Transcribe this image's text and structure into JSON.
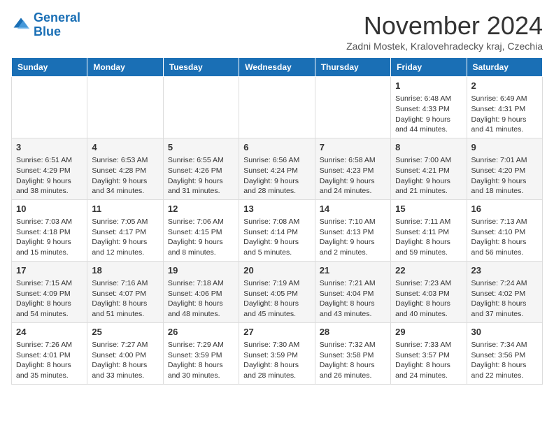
{
  "logo": {
    "line1": "General",
    "line2": "Blue"
  },
  "title": "November 2024",
  "location": "Zadni Mostek, Kralovehradecky kraj, Czechia",
  "weekdays": [
    "Sunday",
    "Monday",
    "Tuesday",
    "Wednesday",
    "Thursday",
    "Friday",
    "Saturday"
  ],
  "weeks": [
    [
      {
        "day": "",
        "info": ""
      },
      {
        "day": "",
        "info": ""
      },
      {
        "day": "",
        "info": ""
      },
      {
        "day": "",
        "info": ""
      },
      {
        "day": "",
        "info": ""
      },
      {
        "day": "1",
        "info": "Sunrise: 6:48 AM\nSunset: 4:33 PM\nDaylight: 9 hours\nand 44 minutes."
      },
      {
        "day": "2",
        "info": "Sunrise: 6:49 AM\nSunset: 4:31 PM\nDaylight: 9 hours\nand 41 minutes."
      }
    ],
    [
      {
        "day": "3",
        "info": "Sunrise: 6:51 AM\nSunset: 4:29 PM\nDaylight: 9 hours\nand 38 minutes."
      },
      {
        "day": "4",
        "info": "Sunrise: 6:53 AM\nSunset: 4:28 PM\nDaylight: 9 hours\nand 34 minutes."
      },
      {
        "day": "5",
        "info": "Sunrise: 6:55 AM\nSunset: 4:26 PM\nDaylight: 9 hours\nand 31 minutes."
      },
      {
        "day": "6",
        "info": "Sunrise: 6:56 AM\nSunset: 4:24 PM\nDaylight: 9 hours\nand 28 minutes."
      },
      {
        "day": "7",
        "info": "Sunrise: 6:58 AM\nSunset: 4:23 PM\nDaylight: 9 hours\nand 24 minutes."
      },
      {
        "day": "8",
        "info": "Sunrise: 7:00 AM\nSunset: 4:21 PM\nDaylight: 9 hours\nand 21 minutes."
      },
      {
        "day": "9",
        "info": "Sunrise: 7:01 AM\nSunset: 4:20 PM\nDaylight: 9 hours\nand 18 minutes."
      }
    ],
    [
      {
        "day": "10",
        "info": "Sunrise: 7:03 AM\nSunset: 4:18 PM\nDaylight: 9 hours\nand 15 minutes."
      },
      {
        "day": "11",
        "info": "Sunrise: 7:05 AM\nSunset: 4:17 PM\nDaylight: 9 hours\nand 12 minutes."
      },
      {
        "day": "12",
        "info": "Sunrise: 7:06 AM\nSunset: 4:15 PM\nDaylight: 9 hours\nand 8 minutes."
      },
      {
        "day": "13",
        "info": "Sunrise: 7:08 AM\nSunset: 4:14 PM\nDaylight: 9 hours\nand 5 minutes."
      },
      {
        "day": "14",
        "info": "Sunrise: 7:10 AM\nSunset: 4:13 PM\nDaylight: 9 hours\nand 2 minutes."
      },
      {
        "day": "15",
        "info": "Sunrise: 7:11 AM\nSunset: 4:11 PM\nDaylight: 8 hours\nand 59 minutes."
      },
      {
        "day": "16",
        "info": "Sunrise: 7:13 AM\nSunset: 4:10 PM\nDaylight: 8 hours\nand 56 minutes."
      }
    ],
    [
      {
        "day": "17",
        "info": "Sunrise: 7:15 AM\nSunset: 4:09 PM\nDaylight: 8 hours\nand 54 minutes."
      },
      {
        "day": "18",
        "info": "Sunrise: 7:16 AM\nSunset: 4:07 PM\nDaylight: 8 hours\nand 51 minutes."
      },
      {
        "day": "19",
        "info": "Sunrise: 7:18 AM\nSunset: 4:06 PM\nDaylight: 8 hours\nand 48 minutes."
      },
      {
        "day": "20",
        "info": "Sunrise: 7:19 AM\nSunset: 4:05 PM\nDaylight: 8 hours\nand 45 minutes."
      },
      {
        "day": "21",
        "info": "Sunrise: 7:21 AM\nSunset: 4:04 PM\nDaylight: 8 hours\nand 43 minutes."
      },
      {
        "day": "22",
        "info": "Sunrise: 7:23 AM\nSunset: 4:03 PM\nDaylight: 8 hours\nand 40 minutes."
      },
      {
        "day": "23",
        "info": "Sunrise: 7:24 AM\nSunset: 4:02 PM\nDaylight: 8 hours\nand 37 minutes."
      }
    ],
    [
      {
        "day": "24",
        "info": "Sunrise: 7:26 AM\nSunset: 4:01 PM\nDaylight: 8 hours\nand 35 minutes."
      },
      {
        "day": "25",
        "info": "Sunrise: 7:27 AM\nSunset: 4:00 PM\nDaylight: 8 hours\nand 33 minutes."
      },
      {
        "day": "26",
        "info": "Sunrise: 7:29 AM\nSunset: 3:59 PM\nDaylight: 8 hours\nand 30 minutes."
      },
      {
        "day": "27",
        "info": "Sunrise: 7:30 AM\nSunset: 3:59 PM\nDaylight: 8 hours\nand 28 minutes."
      },
      {
        "day": "28",
        "info": "Sunrise: 7:32 AM\nSunset: 3:58 PM\nDaylight: 8 hours\nand 26 minutes."
      },
      {
        "day": "29",
        "info": "Sunrise: 7:33 AM\nSunset: 3:57 PM\nDaylight: 8 hours\nand 24 minutes."
      },
      {
        "day": "30",
        "info": "Sunrise: 7:34 AM\nSunset: 3:56 PM\nDaylight: 8 hours\nand 22 minutes."
      }
    ]
  ]
}
